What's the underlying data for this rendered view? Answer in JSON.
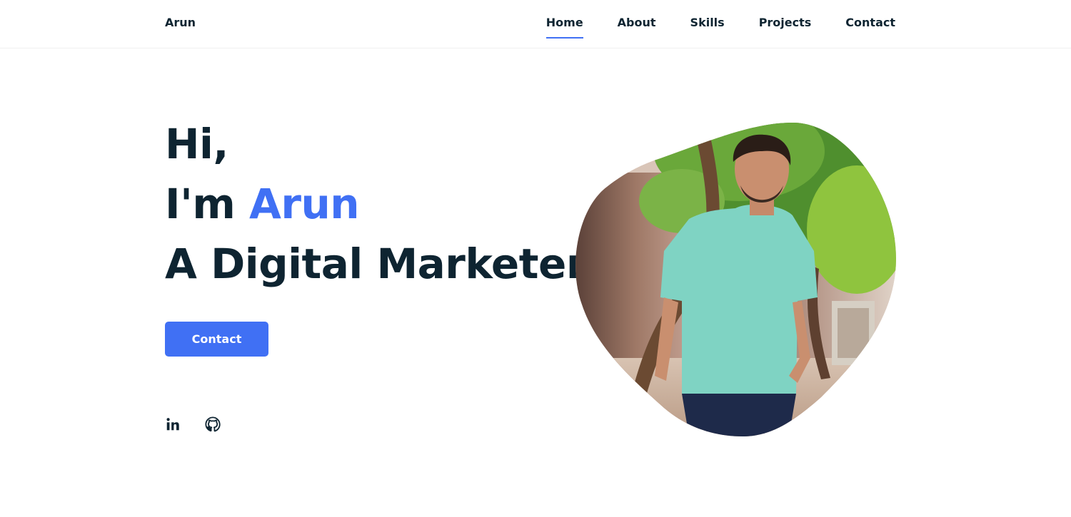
{
  "header": {
    "logo": "Arun",
    "nav": [
      {
        "label": "Home",
        "active": true
      },
      {
        "label": "About",
        "active": false
      },
      {
        "label": "Skills",
        "active": false
      },
      {
        "label": "Projects",
        "active": false
      },
      {
        "label": "Contact",
        "active": false
      }
    ]
  },
  "hero": {
    "line1": "Hi,",
    "line2_prefix": "I'm ",
    "line2_name": "Arun",
    "line3": "A Digital Marketer",
    "button_label": "Contact"
  },
  "socials": [
    {
      "icon": "linkedin-icon"
    },
    {
      "icon": "github-icon"
    }
  ],
  "colors": {
    "accent": "#4070f4",
    "text": "#0e2431"
  }
}
